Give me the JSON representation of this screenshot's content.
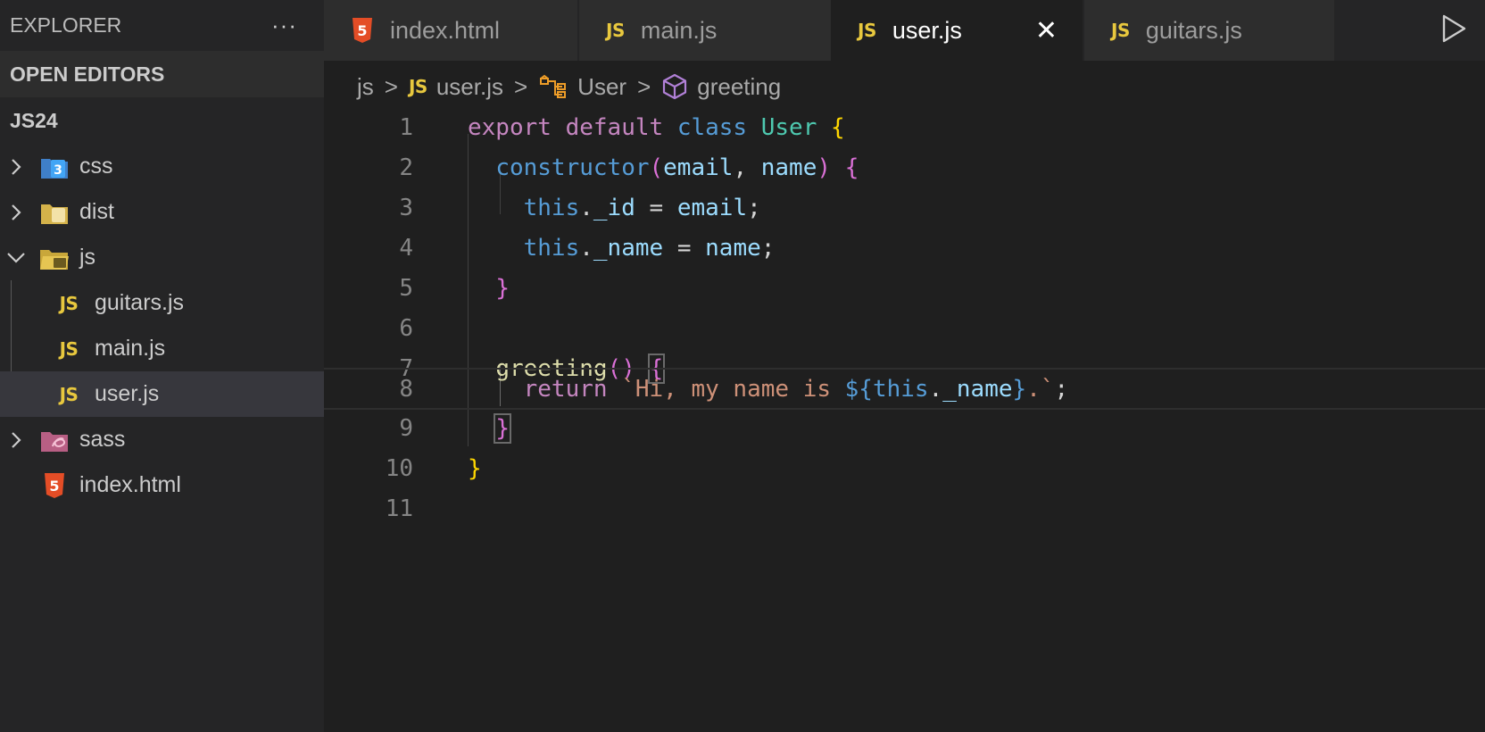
{
  "sidebar": {
    "title": "EXPLORER",
    "more_label": "···",
    "open_editors_label": "OPEN EDITORS",
    "project_label": "JS24",
    "items": [
      {
        "label": "css",
        "icon": "css-folder-icon"
      },
      {
        "label": "dist",
        "icon": "dist-folder-icon"
      },
      {
        "label": "js",
        "icon": "js-folder-icon"
      },
      {
        "label": "guitars.js",
        "icon": "js-file-icon"
      },
      {
        "label": "main.js",
        "icon": "js-file-icon"
      },
      {
        "label": "user.js",
        "icon": "js-file-icon"
      },
      {
        "label": "sass",
        "icon": "sass-folder-icon"
      },
      {
        "label": "index.html",
        "icon": "html-file-icon"
      }
    ],
    "selected": "user.js"
  },
  "tabs": [
    {
      "label": "index.html",
      "icon": "html-file-icon"
    },
    {
      "label": "main.js",
      "icon": "js-file-icon"
    },
    {
      "label": "user.js",
      "icon": "js-file-icon",
      "active": true,
      "close": "✕"
    },
    {
      "label": "guitars.js",
      "icon": "js-file-icon"
    }
  ],
  "js_badge": "JS",
  "breadcrumb": {
    "folder": "js",
    "file": "user.js",
    "class": "User",
    "method": "greeting",
    "separator": ">"
  },
  "editor": {
    "line_numbers": [
      "1",
      "2",
      "3",
      "4",
      "5",
      "6",
      "7",
      "8",
      "9",
      "10",
      "11"
    ],
    "current_line": "8",
    "tokens": {
      "export": "export",
      "default": "default",
      "class": "class",
      "User": "User",
      "constructor": "constructor",
      "email": "email",
      "name": "name",
      "this": "this",
      "_id": "_id",
      "_name": "_name",
      "greeting": "greeting",
      "return": "return",
      "str_start": "`Hi, my name is ",
      "tpl_open": "${",
      "tpl_close": "}",
      "str_end": ".`"
    }
  },
  "colors": {
    "keyword": "#c586c0",
    "storage": "#569cd6",
    "type": "#4ec9b0",
    "function": "#dcdcaa",
    "variable": "#9cdcfe",
    "string": "#ce9178",
    "brace1": "#ffd700",
    "brace2": "#da70d6",
    "js_yellow": "#e8c83e",
    "html_orange": "#e44d26"
  }
}
